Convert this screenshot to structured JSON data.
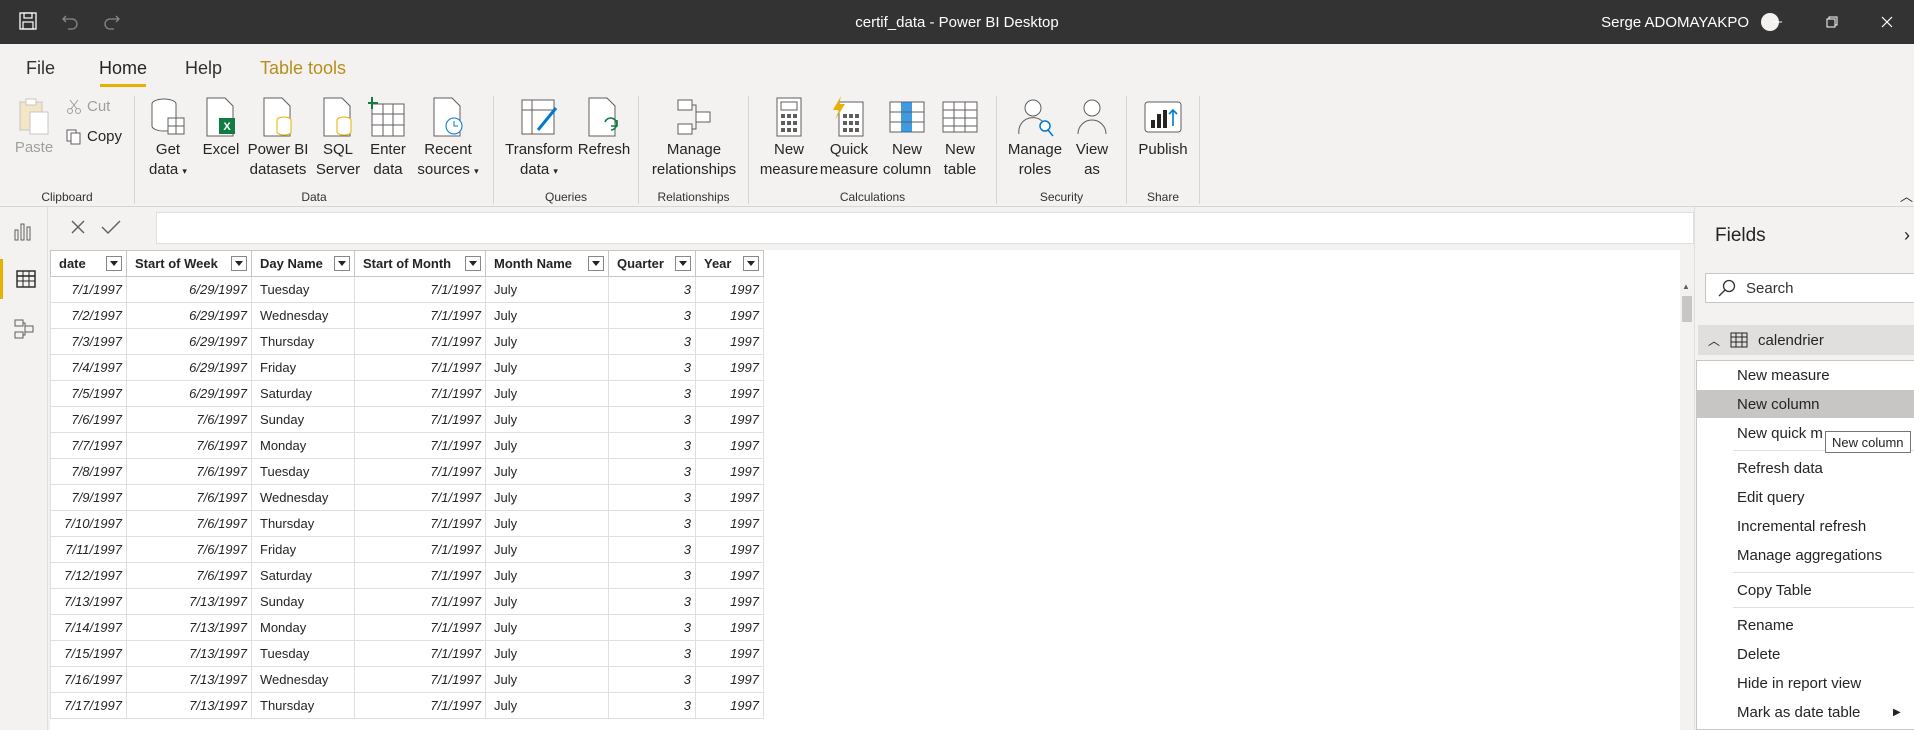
{
  "window": {
    "title": "certif_data - Power BI Desktop",
    "user": "Serge ADOMAYAKPO"
  },
  "menu": {
    "tabs": [
      "File",
      "Home",
      "Help",
      "Table tools"
    ]
  },
  "ribbon": {
    "clipboard": {
      "paste": "Paste",
      "cut": "Cut",
      "copy": "Copy",
      "label": "Clipboard"
    },
    "data": {
      "get_data": [
        "Get",
        "data"
      ],
      "excel": "Excel",
      "pbi_datasets": [
        "Power BI",
        "datasets"
      ],
      "sql": [
        "SQL",
        "Server"
      ],
      "enter_data": [
        "Enter",
        "data"
      ],
      "recent": [
        "Recent",
        "sources"
      ],
      "label": "Data"
    },
    "queries": {
      "transform": [
        "Transform",
        "data"
      ],
      "refresh": "Refresh",
      "label": "Queries"
    },
    "relationships": {
      "manage": [
        "Manage",
        "relationships"
      ],
      "label": "Relationships"
    },
    "calculations": {
      "new_measure": [
        "New",
        "measure"
      ],
      "quick_measure": [
        "Quick",
        "measure"
      ],
      "new_column": [
        "New",
        "column"
      ],
      "new_table": [
        "New",
        "table"
      ],
      "label": "Calculations"
    },
    "security": {
      "manage_roles": [
        "Manage",
        "roles"
      ],
      "view_as": [
        "View",
        "as"
      ],
      "label": "Security"
    },
    "share": {
      "publish": "Publish",
      "label": "Share"
    }
  },
  "table": {
    "columns": [
      "date",
      "Start of Week",
      "Day Name",
      "Start of Month",
      "Month Name",
      "Quarter",
      "Year"
    ],
    "rows": [
      [
        "7/1/1997",
        "6/29/1997",
        "Tuesday",
        "7/1/1997",
        "July",
        "3",
        "1997"
      ],
      [
        "7/2/1997",
        "6/29/1997",
        "Wednesday",
        "7/1/1997",
        "July",
        "3",
        "1997"
      ],
      [
        "7/3/1997",
        "6/29/1997",
        "Thursday",
        "7/1/1997",
        "July",
        "3",
        "1997"
      ],
      [
        "7/4/1997",
        "6/29/1997",
        "Friday",
        "7/1/1997",
        "July",
        "3",
        "1997"
      ],
      [
        "7/5/1997",
        "6/29/1997",
        "Saturday",
        "7/1/1997",
        "July",
        "3",
        "1997"
      ],
      [
        "7/6/1997",
        "7/6/1997",
        "Sunday",
        "7/1/1997",
        "July",
        "3",
        "1997"
      ],
      [
        "7/7/1997",
        "7/6/1997",
        "Monday",
        "7/1/1997",
        "July",
        "3",
        "1997"
      ],
      [
        "7/8/1997",
        "7/6/1997",
        "Tuesday",
        "7/1/1997",
        "July",
        "3",
        "1997"
      ],
      [
        "7/9/1997",
        "7/6/1997",
        "Wednesday",
        "7/1/1997",
        "July",
        "3",
        "1997"
      ],
      [
        "7/10/1997",
        "7/6/1997",
        "Thursday",
        "7/1/1997",
        "July",
        "3",
        "1997"
      ],
      [
        "7/11/1997",
        "7/6/1997",
        "Friday",
        "7/1/1997",
        "July",
        "3",
        "1997"
      ],
      [
        "7/12/1997",
        "7/6/1997",
        "Saturday",
        "7/1/1997",
        "July",
        "3",
        "1997"
      ],
      [
        "7/13/1997",
        "7/13/1997",
        "Sunday",
        "7/1/1997",
        "July",
        "3",
        "1997"
      ],
      [
        "7/14/1997",
        "7/13/1997",
        "Monday",
        "7/1/1997",
        "July",
        "3",
        "1997"
      ],
      [
        "7/15/1997",
        "7/13/1997",
        "Tuesday",
        "7/1/1997",
        "July",
        "3",
        "1997"
      ],
      [
        "7/16/1997",
        "7/13/1997",
        "Wednesday",
        "7/1/1997",
        "July",
        "3",
        "1997"
      ],
      [
        "7/17/1997",
        "7/13/1997",
        "Thursday",
        "7/1/1997",
        "July",
        "3",
        "1997"
      ]
    ]
  },
  "fields": {
    "title": "Fields",
    "search_placeholder": "Search",
    "table_name": "calendrier"
  },
  "context_menu": {
    "items": [
      "New measure",
      "New column",
      "New quick m",
      "Refresh data",
      "Edit query",
      "Incremental refresh",
      "Manage aggregations",
      "Copy Table",
      "Rename",
      "Delete",
      "Hide in report view",
      "Mark as date table"
    ],
    "tooltip": "New column"
  },
  "colors": {
    "accent": "#e8b000",
    "titlebar": "#333333",
    "table_tools": "#b88e1b"
  }
}
